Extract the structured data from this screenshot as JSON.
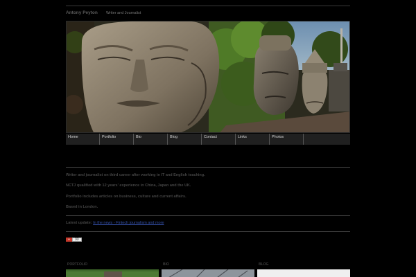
{
  "site": {
    "title": "Antony Peyton",
    "tagline": "Writer and Journalist"
  },
  "nav": {
    "items": [
      "Home",
      "Portfolio",
      "Bio",
      "Blog",
      "Contact",
      "Links",
      "Photos"
    ]
  },
  "intro": {
    "line1": "Writer and journalist on third career after working in IT and English teaching.",
    "line2": "NCTJ qualified with 12 years' experience in China, Japan and the UK.",
    "line3": "Portfolio includes articles on business, culture and current affairs.",
    "line4": "Based in London."
  },
  "latest": {
    "label": "Latest update:",
    "link": "In the news - Fintech journalism and more"
  },
  "share": {
    "count": "33"
  },
  "sections": {
    "portfolio": "PORTFOLIO",
    "bio": "BIO",
    "blog": "BLOG"
  },
  "colors": {
    "background": "#000000",
    "nav_bg": "#202020",
    "link": "#3450a8"
  }
}
